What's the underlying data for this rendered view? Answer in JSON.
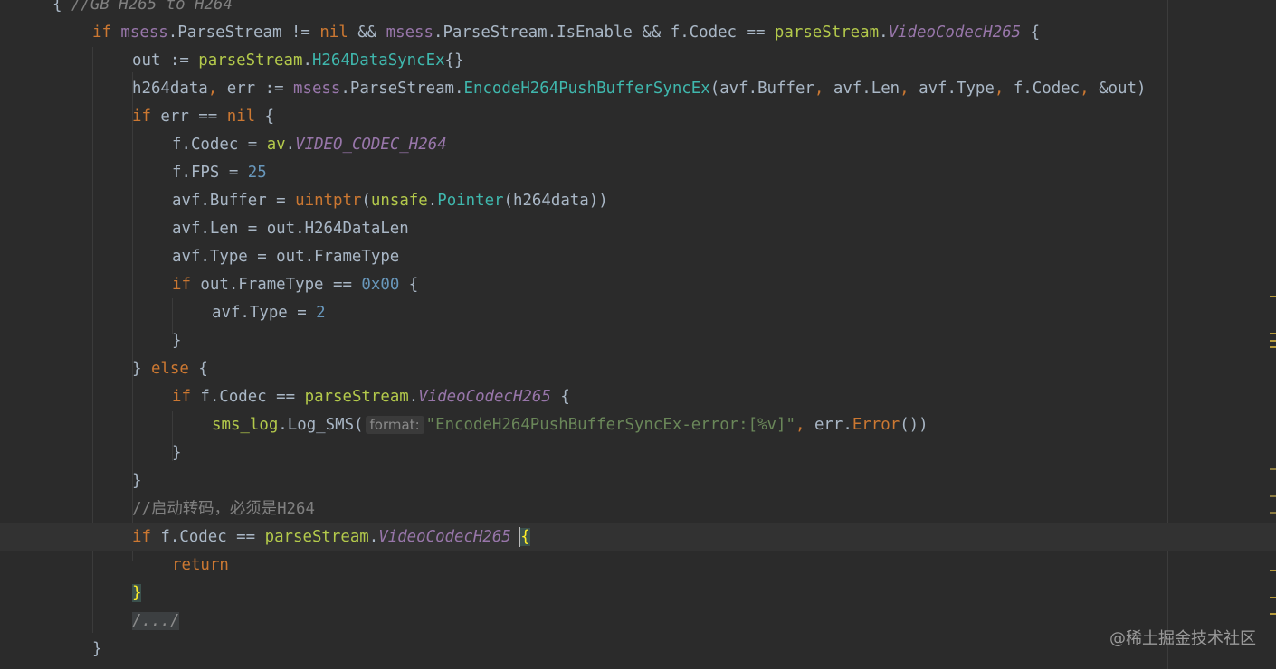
{
  "editor": {
    "lines": [
      {
        "tokens": [
          {
            "t": "{ ",
            "c": ""
          },
          {
            "t": "//GB H265 to H264",
            "c": "cmt ital"
          }
        ]
      },
      {
        "tokens": [
          {
            "t": "if ",
            "c": "kw"
          },
          {
            "t": "msess",
            "c": "fld"
          },
          {
            "t": ".ParseStream != ",
            "c": ""
          },
          {
            "t": "nil",
            "c": "kw"
          },
          {
            "t": " && ",
            "c": ""
          },
          {
            "t": "msess",
            "c": "fld"
          },
          {
            "t": ".ParseStream.IsEnable && f.Codec == ",
            "c": ""
          },
          {
            "t": "parseStream",
            "c": "pkg"
          },
          {
            "t": ".",
            "c": ""
          },
          {
            "t": "VideoCodecH265",
            "c": "fld ital"
          },
          {
            "t": " {",
            "c": ""
          }
        ]
      },
      {
        "tokens": [
          {
            "t": "out := ",
            "c": ""
          },
          {
            "t": "parseStream",
            "c": "pkg"
          },
          {
            "t": ".",
            "c": ""
          },
          {
            "t": "H264DataSyncEx",
            "c": "type"
          },
          {
            "t": "{}",
            "c": ""
          }
        ]
      },
      {
        "tokens": [
          {
            "t": "h264data",
            "c": ""
          },
          {
            "t": ", ",
            "c": "kw"
          },
          {
            "t": "err := ",
            "c": ""
          },
          {
            "t": "msess",
            "c": "fld"
          },
          {
            "t": ".ParseStream.",
            "c": ""
          },
          {
            "t": "EncodeH264PushBufferSyncEx",
            "c": "type"
          },
          {
            "t": "(avf.Buffer",
            "c": ""
          },
          {
            "t": ", ",
            "c": "kw"
          },
          {
            "t": "avf.Len",
            "c": ""
          },
          {
            "t": ", ",
            "c": "kw"
          },
          {
            "t": "avf.Type",
            "c": ""
          },
          {
            "t": ", ",
            "c": "kw"
          },
          {
            "t": "f.Codec",
            "c": ""
          },
          {
            "t": ", ",
            "c": "kw"
          },
          {
            "t": "&out)",
            "c": ""
          }
        ]
      },
      {
        "tokens": [
          {
            "t": "if ",
            "c": "kw"
          },
          {
            "t": "err == ",
            "c": ""
          },
          {
            "t": "nil",
            "c": "kw"
          },
          {
            "t": " {",
            "c": ""
          }
        ]
      },
      {
        "tokens": [
          {
            "t": "f.Codec = ",
            "c": ""
          },
          {
            "t": "av",
            "c": "pkg"
          },
          {
            "t": ".",
            "c": ""
          },
          {
            "t": "VIDEO_CODEC_H264",
            "c": "fld ital"
          }
        ]
      },
      {
        "tokens": [
          {
            "t": "f.FPS = ",
            "c": ""
          },
          {
            "t": "25",
            "c": "num"
          }
        ]
      },
      {
        "tokens": [
          {
            "t": "avf.Buffer = ",
            "c": ""
          },
          {
            "t": "uintptr",
            "c": "kw"
          },
          {
            "t": "(",
            "c": ""
          },
          {
            "t": "unsafe",
            "c": "pkg"
          },
          {
            "t": ".",
            "c": ""
          },
          {
            "t": "Pointer",
            "c": "type"
          },
          {
            "t": "(h264data))",
            "c": ""
          }
        ]
      },
      {
        "tokens": [
          {
            "t": "avf.Len = out.H264DataLen",
            "c": ""
          }
        ]
      },
      {
        "tokens": [
          {
            "t": "avf.Type = out.FrameType",
            "c": ""
          }
        ]
      },
      {
        "tokens": [
          {
            "t": "if ",
            "c": "kw"
          },
          {
            "t": "out.FrameType == ",
            "c": ""
          },
          {
            "t": "0x00",
            "c": "num"
          },
          {
            "t": " {",
            "c": ""
          }
        ]
      },
      {
        "tokens": [
          {
            "t": "avf.Type = ",
            "c": ""
          },
          {
            "t": "2",
            "c": "num"
          }
        ]
      },
      {
        "tokens": [
          {
            "t": "}",
            "c": ""
          }
        ]
      },
      {
        "tokens": [
          {
            "t": "} ",
            "c": ""
          },
          {
            "t": "else",
            "c": "kw"
          },
          {
            "t": " {",
            "c": ""
          }
        ]
      },
      {
        "tokens": [
          {
            "t": "if ",
            "c": "kw"
          },
          {
            "t": "f.Codec == ",
            "c": ""
          },
          {
            "t": "parseStream",
            "c": "pkg"
          },
          {
            "t": ".",
            "c": ""
          },
          {
            "t": "VideoCodecH265",
            "c": "fld ital"
          },
          {
            "t": " {",
            "c": ""
          }
        ]
      },
      {
        "tokens": [
          {
            "t": "sms_log",
            "c": "pkg"
          },
          {
            "t": ".Log_SMS(",
            "c": ""
          },
          {
            "t": "format:",
            "c": "hint"
          },
          {
            "t": "\"EncodeH264PushBufferSyncEx-error:[%v]\"",
            "c": "str"
          },
          {
            "t": ", ",
            "c": "kw"
          },
          {
            "t": "err.",
            "c": ""
          },
          {
            "t": "Error",
            "c": "kw"
          },
          {
            "t": "())",
            "c": ""
          }
        ]
      },
      {
        "tokens": [
          {
            "t": "}",
            "c": ""
          }
        ]
      },
      {
        "tokens": [
          {
            "t": "}",
            "c": ""
          }
        ]
      },
      {
        "tokens": [
          {
            "t": "//启动转码，必须是H264",
            "c": "cmt"
          }
        ]
      },
      {
        "tokens": [
          {
            "t": "if ",
            "c": "kw"
          },
          {
            "t": "f.Codec == ",
            "c": ""
          },
          {
            "t": "parseStream",
            "c": "pkg"
          },
          {
            "t": ".",
            "c": ""
          },
          {
            "t": "VideoCodecH265",
            "c": "fld ital"
          },
          {
            "t": " ",
            "c": ""
          },
          {
            "t": "{",
            "c": "brace-hl"
          }
        ]
      },
      {
        "tokens": [
          {
            "t": "return",
            "c": "kw"
          }
        ]
      },
      {
        "tokens": [
          {
            "t": "}",
            "c": "brace-hl"
          }
        ]
      },
      {
        "tokens": [
          {
            "t": "/.../",
            "c": "fold ital"
          }
        ]
      },
      {
        "tokens": [
          {
            "t": "}",
            "c": ""
          }
        ]
      }
    ]
  },
  "watermark": "@稀土掘金技术社区",
  "colors": {
    "background": "#2b2b2b",
    "keyword": "#cc7832",
    "function": "#ffc66d",
    "string": "#6a8759",
    "number": "#6897bb",
    "comment": "#808080",
    "field": "#9876aa"
  }
}
